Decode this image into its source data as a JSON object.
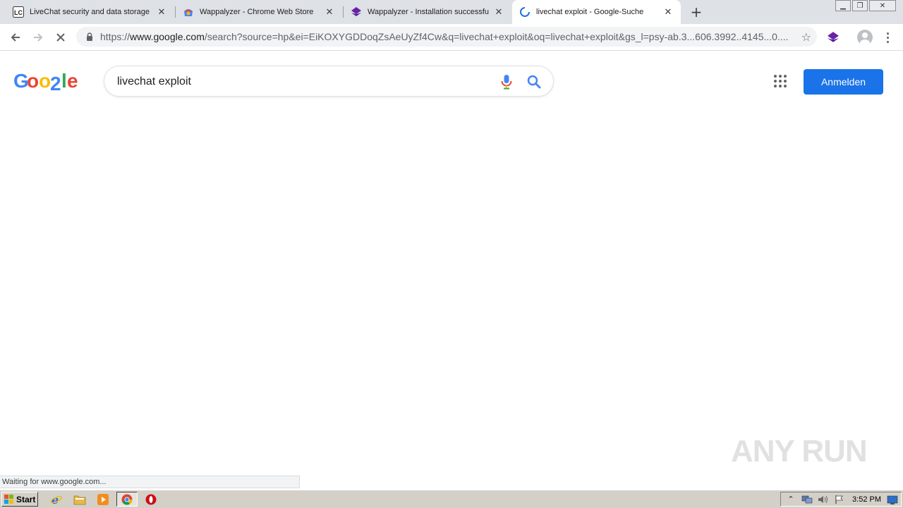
{
  "browser": {
    "tabs": [
      {
        "title": "LiveChat security and data storage |",
        "favicon": "livechat-lc-icon"
      },
      {
        "title": "Wappalyzer - Chrome Web Store",
        "favicon": "chrome-web-store-icon"
      },
      {
        "title": "Wappalyzer - Installation successful",
        "favicon": "wappalyzer-icon"
      },
      {
        "title": "livechat exploit - Google-Suche",
        "favicon": "loading-spinner-icon",
        "active": true
      }
    ],
    "new_tab_symbol": "+",
    "address": {
      "scheme": "https://",
      "host": "www.google.com",
      "rest": "/search?source=hp&ei=EiKOXYGDDoqZsAeUyZf4Cw&q=livechat+exploit&oq=livechat+exploit&gs_l=psy-ab.3...606.3992..4145...0...."
    }
  },
  "google": {
    "logo_text": "Google",
    "query": "livechat exploit",
    "signin_label": "Anmelden"
  },
  "status_text": "Waiting for www.google.com...",
  "watermark": "ANY RUN",
  "taskbar": {
    "start_label": "Start",
    "clock": "3:52 PM"
  },
  "colors": {
    "accent": "#1a73e8",
    "tabstrip": "#dee1e6",
    "taskbar": "#d4d0c8"
  }
}
